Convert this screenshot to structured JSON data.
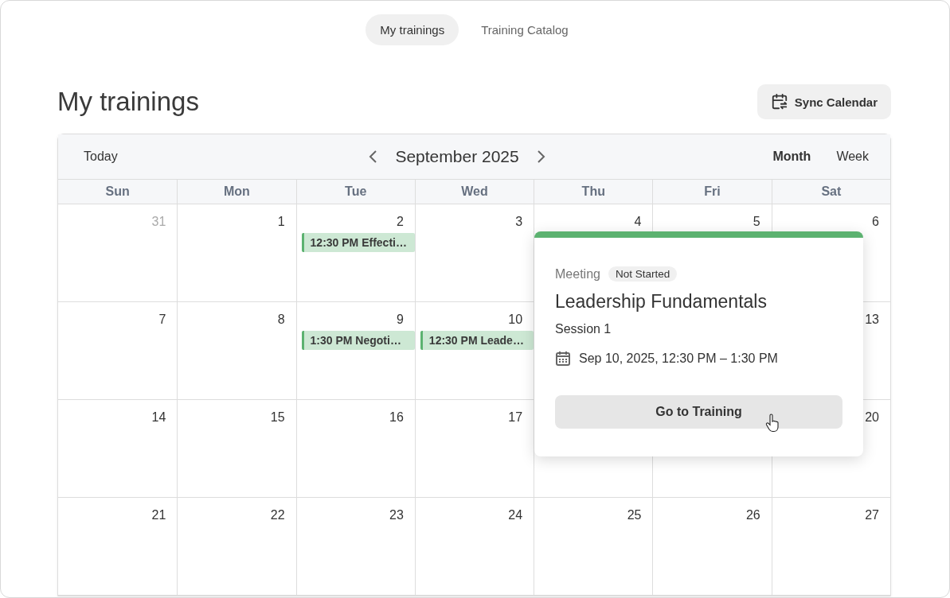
{
  "tabs": [
    {
      "label": "My trainings",
      "selected": true
    },
    {
      "label": "Training Catalog",
      "selected": false
    }
  ],
  "page_title": "My trainings",
  "sync_button": "Sync Calendar",
  "calendar": {
    "today_button": "Today",
    "month_label": "September 2025",
    "views": [
      {
        "label": "Month",
        "selected": true
      },
      {
        "label": "Week",
        "selected": false
      }
    ],
    "weekdays": [
      "Sun",
      "Mon",
      "Tue",
      "Wed",
      "Thu",
      "Fri",
      "Sat"
    ],
    "weeks": [
      {
        "days_left": [
          {
            "day": "31",
            "other_month": true
          },
          {
            "day": "1",
            "other_month": false
          },
          {
            "day": "2",
            "other_month": false,
            "events": [
              "12:30 PM Effecti…"
            ]
          },
          {
            "day": "3",
            "other_month": false
          },
          {
            "day": "4",
            "other_month": false
          },
          {
            "day": "5",
            "other_month": false
          },
          {
            "day": "6",
            "other_month": false
          }
        ]
      },
      {
        "days_left": [
          {
            "day": "7",
            "other_month": false
          },
          {
            "day": "8",
            "other_month": false
          },
          {
            "day": "9",
            "other_month": false,
            "events": [
              "1:30 PM Negoti…"
            ]
          },
          {
            "day": "10",
            "other_month": false,
            "events": [
              "12:30 PM Leade…"
            ]
          }
        ],
        "days_right": [
          {
            "day": "13",
            "other_month": false
          }
        ]
      },
      {
        "days_left": [
          {
            "day": "14",
            "other_month": false
          },
          {
            "day": "15",
            "other_month": false
          },
          {
            "day": "16",
            "other_month": false
          },
          {
            "day": "17",
            "other_month": false
          }
        ],
        "days_right": [
          {
            "day": "20",
            "other_month": false
          }
        ]
      },
      {
        "days_left": [
          {
            "day": "21",
            "other_month": false
          },
          {
            "day": "22",
            "other_month": false
          },
          {
            "day": "23",
            "other_month": false
          },
          {
            "day": "24",
            "other_month": false
          },
          {
            "day": "25",
            "other_month": false
          },
          {
            "day": "26",
            "other_month": false
          },
          {
            "day": "27",
            "other_month": false
          }
        ]
      }
    ],
    "popover": {
      "type": "Meeting",
      "status": "Not Started",
      "title": "Leadership Fundamentals",
      "session": "Session 1",
      "datetime": "Sep 10, 2025, 12:30 PM – 1:30 PM",
      "action": "Go to Training"
    }
  }
}
